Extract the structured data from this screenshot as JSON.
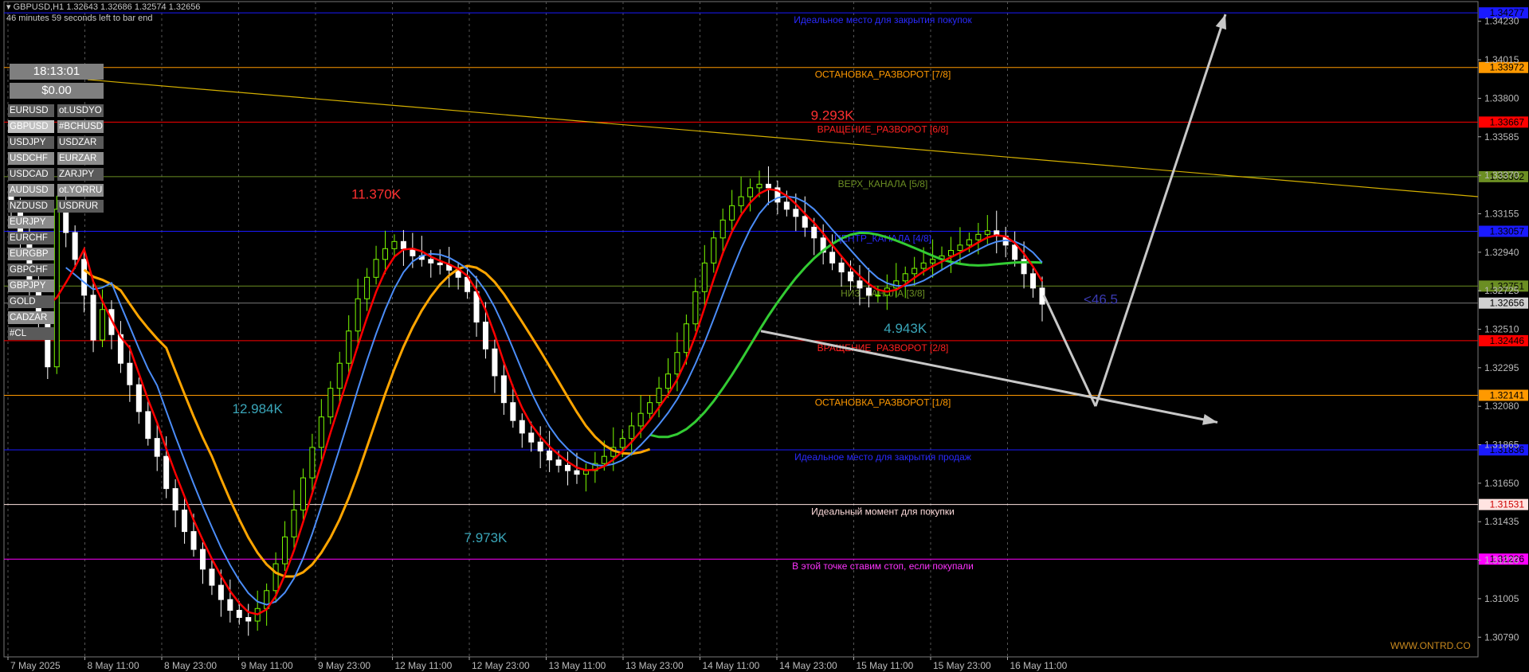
{
  "header": {
    "symbol_line": "GBPUSD,H1  1.32643 1.32686 1.32574 1.32656",
    "timer_line": "46 minutes 59 seconds left to bar end"
  },
  "panel": {
    "clock": "18:13:01",
    "balance": "$0.00",
    "left_column": [
      "EURUSD",
      "GBPUSD",
      "USDJPY",
      "USDCHF",
      "USDCAD",
      "AUDUSD",
      "NZDUSD",
      "EURJPY",
      "EURCHF",
      "EURGBP",
      "GBPCHF",
      "GBPJPY",
      "GOLD",
      "CADZAR",
      "#CL"
    ],
    "right_column": [
      "ot.USDYO",
      "#BCHUSD",
      "USDZAR",
      "EURZAR",
      "ZARJPY",
      "ot.YORRU",
      "USDRUR"
    ],
    "selected": "GBPUSD"
  },
  "chart_data": {
    "type": "candlestick",
    "symbol": "GBPUSD",
    "timeframe": "H1",
    "ylim": [
      1.3068,
      1.3434
    ],
    "price_scale_ticks": [
      1.3423,
      1.34015,
      1.338,
      1.33585,
      1.3337,
      1.33155,
      1.3294,
      1.32725,
      1.3251,
      1.32295,
      1.3208,
      1.31865,
      1.3165,
      1.31435,
      1.3122,
      1.31005,
      1.3079
    ],
    "time_labels": [
      "7 May 2025",
      "8 May 11:00",
      "8 May 23:00",
      "9 May 11:00",
      "9 May 23:00",
      "12 May 11:00",
      "12 May 23:00",
      "13 May 11:00",
      "13 May 23:00",
      "14 May 11:00",
      "14 May 23:00",
      "15 May 11:00",
      "15 May 23:00",
      "16 May 11:00"
    ],
    "levels": [
      {
        "price": 1.34277,
        "label": "Идеальное место для закрытия покупок",
        "value_label": "1.34277",
        "color": "#1a1aff",
        "label_color": "#2a2aff"
      },
      {
        "price": 1.33972,
        "label": "ОСТАНОВКА_РАЗВОРОТ [7/8]",
        "value_label": "1.33972",
        "color": "#ff9900",
        "label_color": "#ff9900"
      },
      {
        "price": 1.33667,
        "label": "ВРАЩЕНИЕ_РАЗВОРОТ [6/8]",
        "value_label": "1.33667",
        "color": "#ff0000",
        "label_color": "#ff2020"
      },
      {
        "price": 1.33362,
        "label": "ВЕРХ_КАНАЛА [5/8]",
        "value_label": "1.33362",
        "color": "#6b8e23",
        "label_color": "#6b8e23"
      },
      {
        "price": 1.33057,
        "label": "ЦЕНТР_КАНАЛА [4/8]",
        "value_label": "1.33057",
        "color": "#1a1aff",
        "label_color": "#2a2aff"
      },
      {
        "price": 1.32751,
        "label": "НИЗ_КАНАЛА [3/8]",
        "value_label": "1.32751",
        "color": "#6b8e23",
        "label_color": "#6b8e23"
      },
      {
        "price": 1.32446,
        "label": "ВРАЩЕНИЕ_РАЗВОРОТ [2/8]",
        "value_label": "1.32446",
        "color": "#ff0000",
        "label_color": "#ff2020"
      },
      {
        "price": 1.32141,
        "label": "ОСТАНОВКА_РАЗВОРОТ [1/8]",
        "value_label": "1.32141",
        "color": "#ff9900",
        "label_color": "#ff9900"
      },
      {
        "price": 1.31836,
        "label": "Идеальное место для закрытия продаж",
        "value_label": "1.31836",
        "color": "#1a1aff",
        "label_color": "#2a2aff"
      },
      {
        "price": 1.31531,
        "label": "Идеальный момент для покупки",
        "value_label": "1.31531",
        "color": "#ffe4e1",
        "label_color": "#ffdcdc"
      },
      {
        "price": 1.31226,
        "label": "В этой точке ставим стоп, если покупали",
        "value_label": "1.31226",
        "color": "#ff00ff",
        "label_color": "#ff33ff"
      }
    ],
    "current_price": 1.32656,
    "current_price_label": "1.32656",
    "volume_labels": [
      {
        "text": "11.370K",
        "price": 1.3324,
        "bar": 40,
        "color": "#ff3030"
      },
      {
        "text": "12.984K",
        "price": 1.3204,
        "bar": 27,
        "color": "#3aa6b9"
      },
      {
        "text": "7.973K",
        "price": 1.3132,
        "bar": 52,
        "color": "#3aa6b9"
      },
      {
        "text": "9.293K",
        "price": 1.3368,
        "bar": 90,
        "color": "#ff3030"
      },
      {
        "text": "4.943K",
        "price": 1.3249,
        "bar": 98,
        "color": "#3aa6b9"
      }
    ],
    "pips_label": {
      "text": "<46.5",
      "price": 1.3268,
      "color": "#3a3ab0"
    },
    "watermark": "WWW.ONTRD.CO",
    "closes": [
      1.3318,
      1.33,
      1.3272,
      1.3255,
      1.323,
      1.3318,
      1.3305,
      1.329,
      1.327,
      1.3245,
      1.3262,
      1.3248,
      1.3232,
      1.322,
      1.3205,
      1.319,
      1.318,
      1.3162,
      1.315,
      1.3138,
      1.3128,
      1.3117,
      1.3108,
      1.31,
      1.3094,
      1.309,
      1.3088,
      1.3095,
      1.3105,
      1.312,
      1.3135,
      1.315,
      1.3168,
      1.3185,
      1.3202,
      1.3218,
      1.3232,
      1.325,
      1.3268,
      1.328,
      1.329,
      1.3296,
      1.33,
      1.3296,
      1.3292,
      1.329,
      1.3288,
      1.3287,
      1.3284,
      1.328,
      1.3272,
      1.3255,
      1.324,
      1.3225,
      1.321,
      1.32,
      1.3193,
      1.3188,
      1.3183,
      1.3178,
      1.3175,
      1.3172,
      1.317,
      1.3172,
      1.3176,
      1.318,
      1.3185,
      1.319,
      1.3197,
      1.3204,
      1.321,
      1.3218,
      1.3226,
      1.3238,
      1.3254,
      1.3272,
      1.3288,
      1.3302,
      1.3312,
      1.332,
      1.3325,
      1.333,
      1.3332,
      1.333,
      1.3322,
      1.3318,
      1.3314,
      1.3308,
      1.3302,
      1.3294,
      1.3288,
      1.3283,
      1.3278,
      1.3274,
      1.327,
      1.327,
      1.3274,
      1.3278,
      1.3282,
      1.3285,
      1.3288,
      1.329,
      1.3292,
      1.3295,
      1.3298,
      1.3301,
      1.3304,
      1.3306,
      1.3303,
      1.3298,
      1.329,
      1.3282,
      1.3274,
      1.3265
    ],
    "ma_blue_color": "#4b8df8",
    "ma_red_color": "#ff0000",
    "ma_orange_color": "#ffa500",
    "ma_green_color": "#33cc33",
    "bull_color": "#7cfc00",
    "bear_color": "#ffffff"
  }
}
